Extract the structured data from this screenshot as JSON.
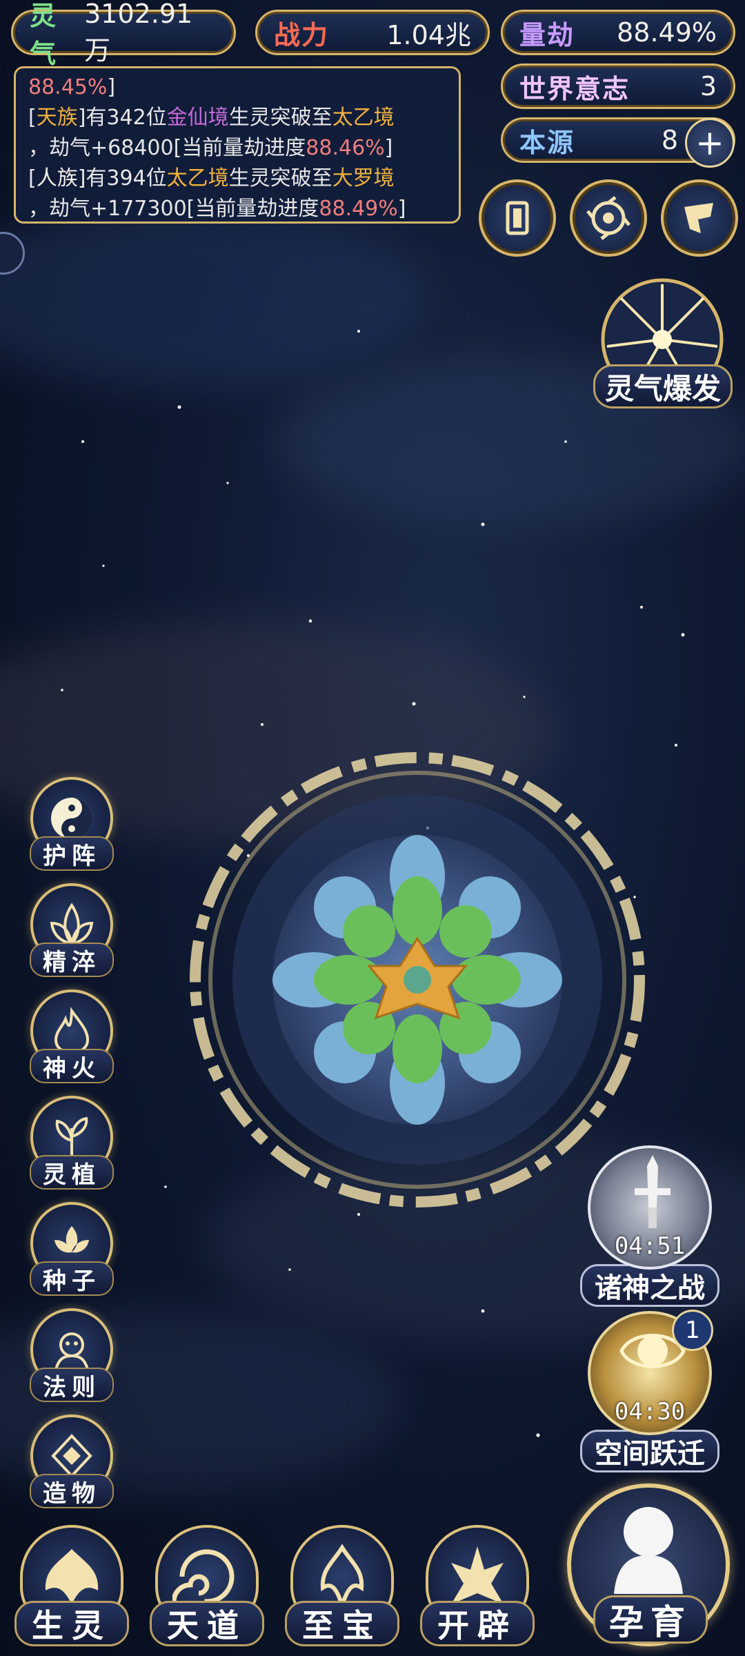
{
  "stats": {
    "lingqi": {
      "label": "灵气",
      "value": "3102.91万"
    },
    "zhanli": {
      "label": "战力",
      "value": "1.04兆"
    },
    "liangjie": {
      "label": "量劫",
      "value": "88.49%"
    },
    "shijie": {
      "label": "世界意志",
      "value": "3"
    },
    "benyuan": {
      "label": "本源",
      "value": "8"
    }
  },
  "log": {
    "line0_pct": "88.45%",
    "line0_bracket": "]",
    "e1_open": "[",
    "e1_race": "天族",
    "e1_mid": "]有342位",
    "e1_realm": "金仙境",
    "e1_rest": "生灵突破至",
    "e1_target": "太乙境",
    "e1_gain": "，劫气+68400[当前量劫进度",
    "e1_pct": "88.46%",
    "e1_close": "]",
    "e2_open": "[",
    "e2_race": "人族",
    "e2_mid": "]有394位",
    "e2_realm": "太乙境",
    "e2_rest": "生灵突破至",
    "e2_target": "大罗境",
    "e2_gain": "，劫气+177300[当前量劫进度",
    "e2_pct": "88.49%",
    "e2_close": "]"
  },
  "burst": {
    "label": "灵气爆发"
  },
  "side_buttons": [
    "护阵",
    "精淬",
    "神火",
    "灵植",
    "种子",
    "法则",
    "造物"
  ],
  "bottom_buttons": [
    "生灵",
    "天道",
    "至宝",
    "开辟"
  ],
  "yunyu": {
    "label": "孕育"
  },
  "war": {
    "label": "诸神之战",
    "time": "04:51"
  },
  "leap": {
    "label": "空间跃迁",
    "time": "04:30",
    "badge": "1"
  },
  "colors": {
    "gold": "#d7b56a",
    "panel": "#12203c",
    "pct_red": "#f07e7e",
    "realm_purple": "#c56ad8",
    "realm_gold": "#f2b23d"
  }
}
